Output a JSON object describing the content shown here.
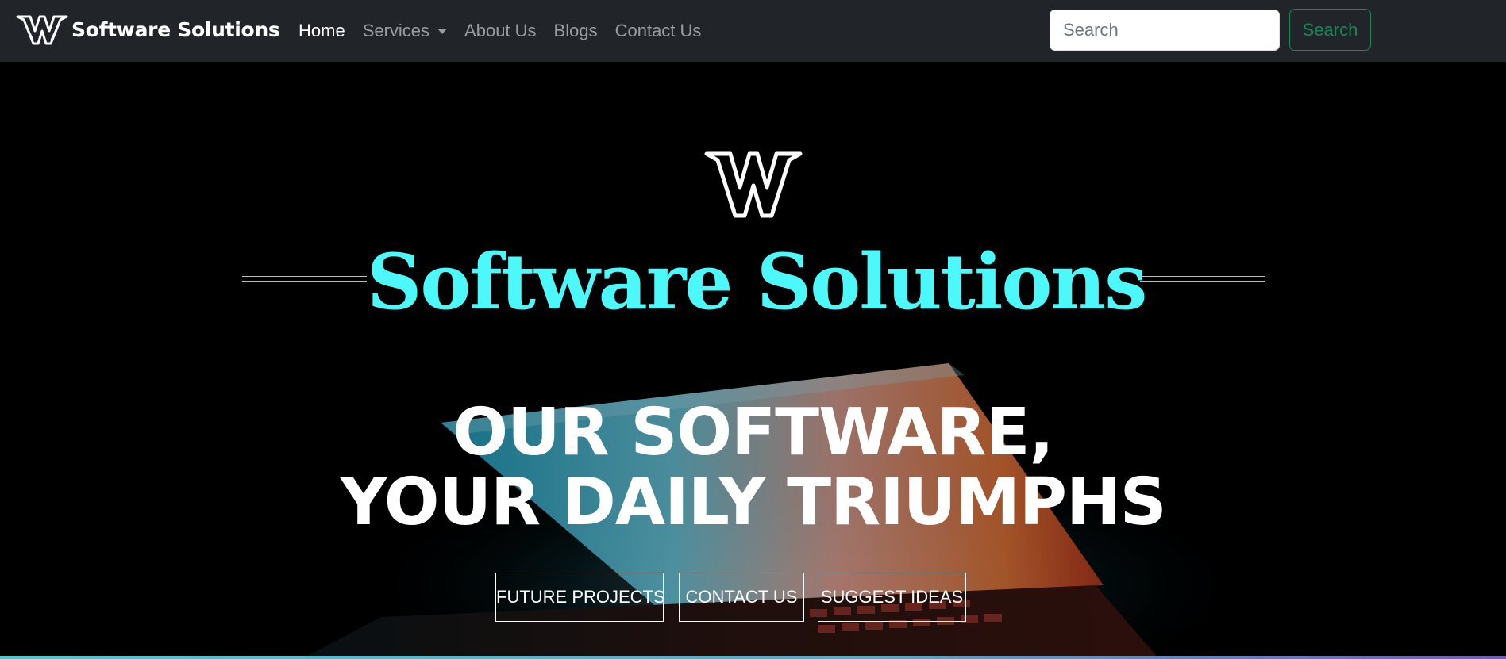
{
  "navbar": {
    "brand": "Software Solutions",
    "links": [
      {
        "label": "Home",
        "active": true
      },
      {
        "label": "Services",
        "dropdown": true
      },
      {
        "label": "About Us"
      },
      {
        "label": "Blogs"
      },
      {
        "label": "Contact Us"
      }
    ],
    "search": {
      "placeholder": "Search",
      "button_label": "Search"
    }
  },
  "hero": {
    "title": "Software Solutions",
    "headline_line1": "OUR SOFTWARE,",
    "headline_line2": "YOUR DAILY TRIUMPHS",
    "buttons": [
      {
        "label": "FUTURE PROJECTS"
      },
      {
        "label": "CONTACT US"
      },
      {
        "label": "SUGGEST IDEAS"
      }
    ]
  },
  "colors": {
    "navbar_bg": "#212529",
    "title_accent": "#4df8fa",
    "search_button": "#198754",
    "hero_bg": "#000000"
  },
  "icons": {
    "brand_logo": "w-logo-icon",
    "hero_logo": "w-logo-icon"
  }
}
